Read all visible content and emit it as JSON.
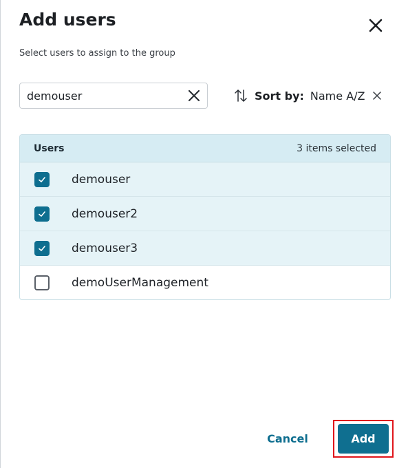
{
  "dialog": {
    "title": "Add users",
    "subtitle": "Select users to assign to the group"
  },
  "search": {
    "value": "demouser",
    "placeholder": ""
  },
  "sort": {
    "label": "Sort by:",
    "value": "Name A/Z"
  },
  "table": {
    "header": "Users",
    "selected_count": "3 items selected",
    "rows": [
      {
        "name": "demouser",
        "checked": true
      },
      {
        "name": "demouser2",
        "checked": true
      },
      {
        "name": "demouser3",
        "checked": true
      },
      {
        "name": "demoUserManagement",
        "checked": false
      }
    ]
  },
  "footer": {
    "cancel_label": "Cancel",
    "add_label": "Add"
  },
  "colors": {
    "accent": "#0e6e8f",
    "header_bg": "#d6ecf3",
    "selected_row_bg": "#e5f3f7",
    "highlight_border": "#e0151b"
  }
}
